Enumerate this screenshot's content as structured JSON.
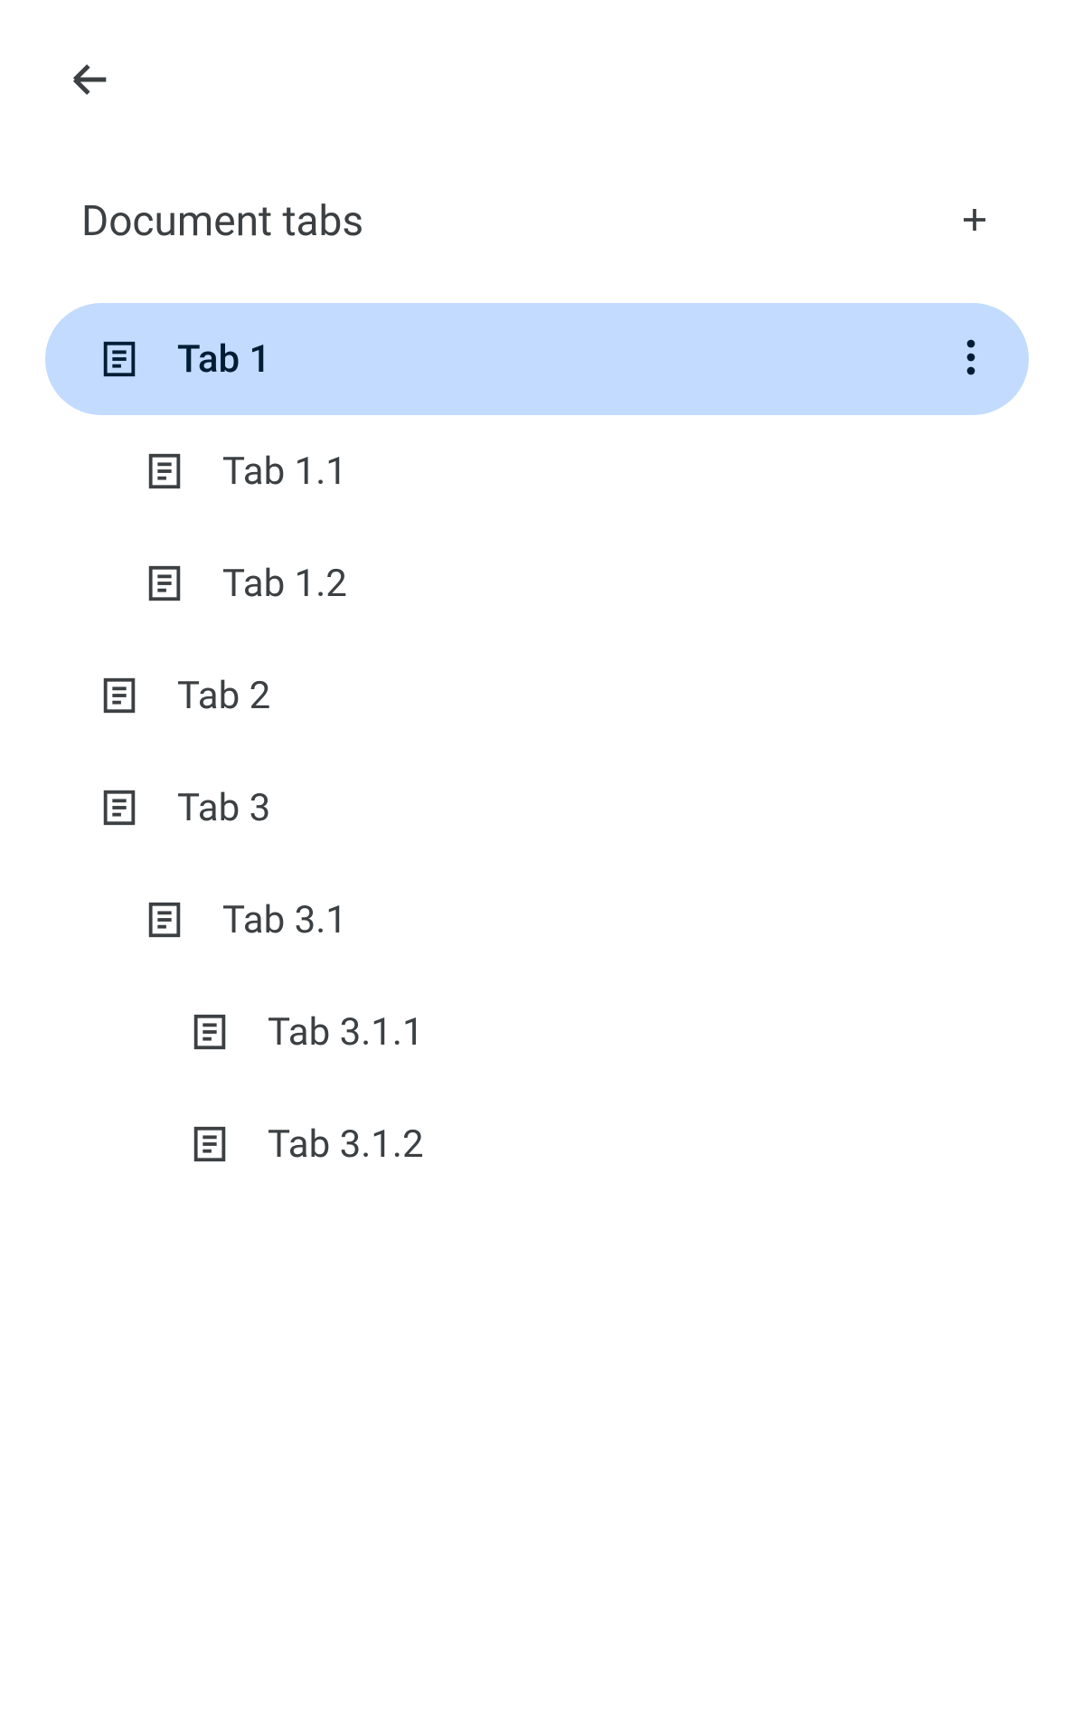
{
  "header": {
    "title": "Document tabs"
  },
  "tabs": [
    {
      "label": "Tab 1",
      "indent": 0,
      "selected": true,
      "showMore": true
    },
    {
      "label": "Tab 1.1",
      "indent": 1,
      "selected": false,
      "showMore": false
    },
    {
      "label": "Tab 1.2",
      "indent": 1,
      "selected": false,
      "showMore": false
    },
    {
      "label": "Tab 2",
      "indent": 0,
      "selected": false,
      "showMore": false
    },
    {
      "label": "Tab 3",
      "indent": 0,
      "selected": false,
      "showMore": false
    },
    {
      "label": "Tab 3.1",
      "indent": 1,
      "selected": false,
      "showMore": false
    },
    {
      "label": "Tab 3.1.1",
      "indent": 2,
      "selected": false,
      "showMore": false
    },
    {
      "label": "Tab 3.1.2",
      "indent": 2,
      "selected": false,
      "showMore": false
    }
  ],
  "colors": {
    "selectedBg": "#c2dbff",
    "selectedText": "#001d35",
    "defaultText": "#3c4043",
    "iconStroke": "#3c4043"
  }
}
